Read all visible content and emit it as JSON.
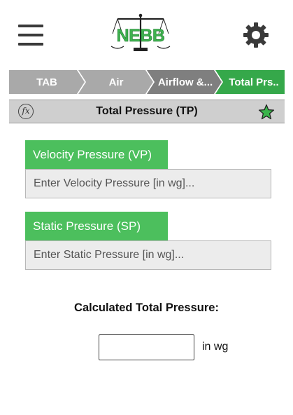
{
  "header": {
    "logo_text": "NEBB",
    "menu_icon": "hamburger-menu-icon",
    "settings_icon": "gear-icon"
  },
  "breadcrumb": [
    {
      "label": "TAB",
      "active": false
    },
    {
      "label": "Air",
      "active": false
    },
    {
      "label": "Airflow &...",
      "active": false
    },
    {
      "label": "Total Prs..",
      "active": true
    }
  ],
  "titlebar": {
    "formula_icon_text": "fx",
    "title": "Total Pressure (TP)",
    "favorite_icon": "star-icon"
  },
  "form": {
    "vp": {
      "label": "Velocity Pressure (VP)",
      "placeholder": "Enter Velocity Pressure [in wg]...",
      "value": ""
    },
    "sp": {
      "label": "Static Pressure (SP)",
      "placeholder": "Enter Static Pressure [in wg]...",
      "value": ""
    }
  },
  "result": {
    "label": "Calculated Total Pressure:",
    "value": "",
    "unit": "in wg"
  },
  "colors": {
    "accent_green": "#4cbf5d",
    "crumb_gray": "#a8a8a8",
    "crumb_dark": "#7f7f7f",
    "titlebar_gray": "#cfcfcf"
  }
}
